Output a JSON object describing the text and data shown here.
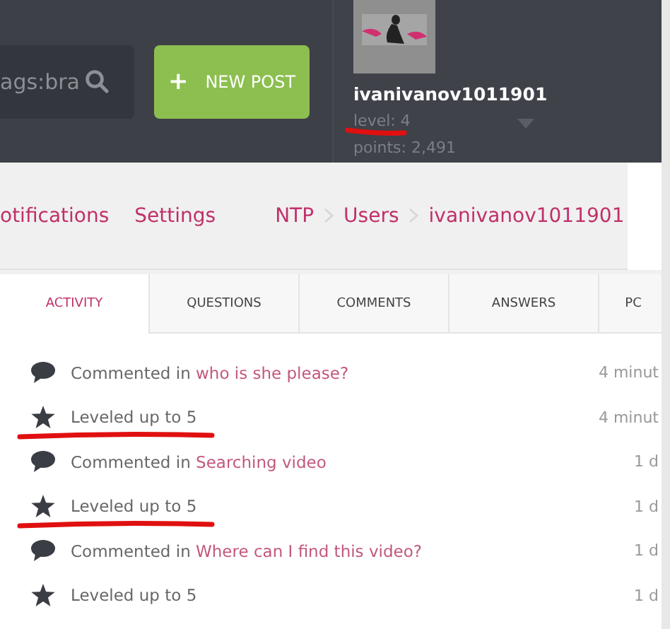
{
  "header": {
    "search": {
      "value": "ags:bra"
    },
    "new_post_button": {
      "icon": "+",
      "label": "NEW POST"
    },
    "user": {
      "username": "ivanivanov1011901",
      "level": "level: 4",
      "level_underlined": true,
      "points": "points: 2,491"
    }
  },
  "nav": {
    "links": [
      "otifications",
      "Settings"
    ],
    "breadcrumb": [
      "NTP",
      "Users",
      "ivanivanov1011901"
    ]
  },
  "tabs": [
    {
      "label": "ACTIVITY",
      "selected": true
    },
    {
      "label": "QUESTIONS",
      "selected": false
    },
    {
      "label": "COMMENTS",
      "selected": false
    },
    {
      "label": "ANSWERS",
      "selected": false
    },
    {
      "label": "PC",
      "selected": false
    }
  ],
  "activity": [
    {
      "kind": "comment",
      "text": "Commented in",
      "link": "who is she please?",
      "time": "4 minut",
      "underlined": false
    },
    {
      "kind": "level",
      "text": "Leveled up to 5",
      "time": "4 minut",
      "underlined": true
    },
    {
      "kind": "comment",
      "text": "Commented in",
      "link": "Searching video",
      "time": "1 d",
      "underlined": false
    },
    {
      "kind": "level",
      "text": "Leveled up to 5",
      "time": "1 d",
      "underlined": true
    },
    {
      "kind": "comment",
      "text": "Commented in",
      "link": "Where can I find this video?",
      "time": "1 d",
      "underlined": false
    },
    {
      "kind": "level",
      "text": "Leveled up to 5",
      "time": "1 d",
      "underlined": false
    }
  ]
}
